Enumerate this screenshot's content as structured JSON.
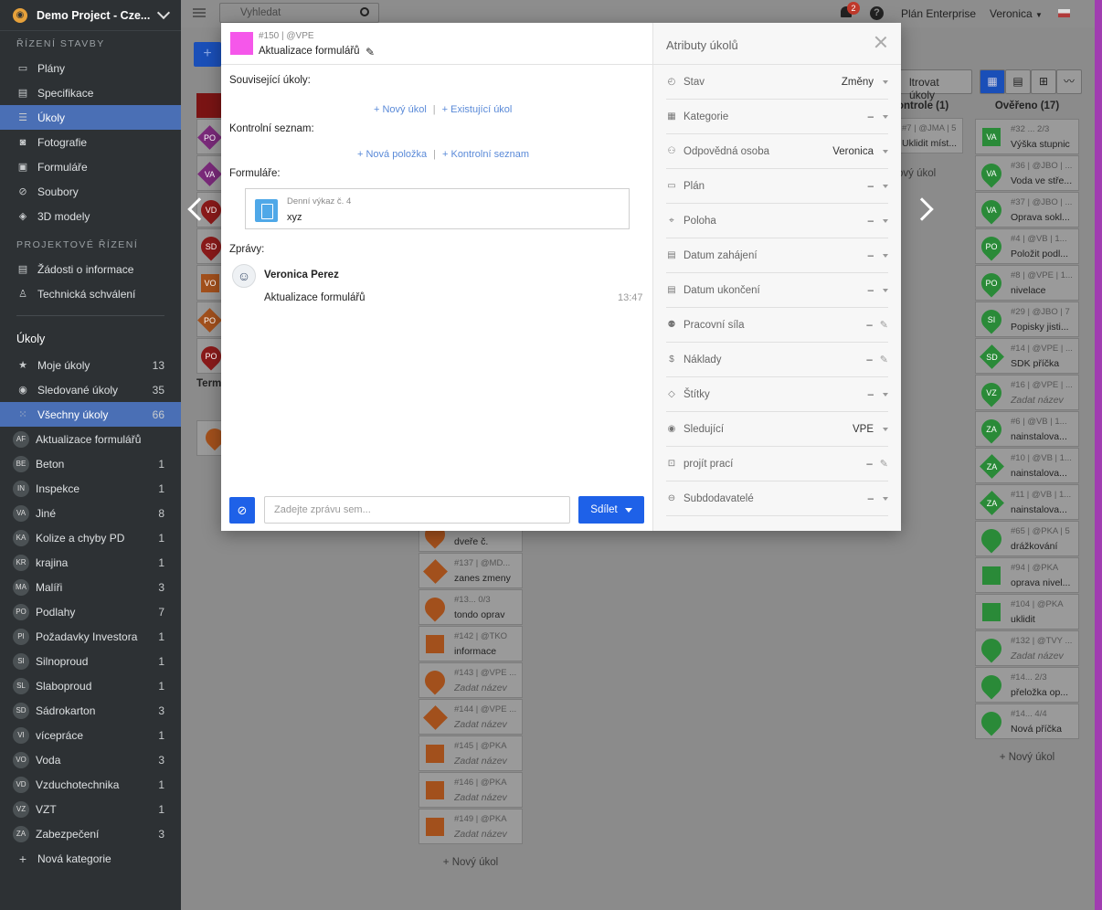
{
  "sidebar": {
    "project_name": "Demo Project - Cze...",
    "section_construction": "ŘÍZENÍ STAVBY",
    "construction_items": [
      {
        "label": "Plány",
        "icon": "map-icon"
      },
      {
        "label": "Specifikace",
        "icon": "book-icon"
      },
      {
        "label": "Úkoly",
        "icon": "list-icon",
        "active": true
      },
      {
        "label": "Fotografie",
        "icon": "camera-icon"
      },
      {
        "label": "Formuláře",
        "icon": "form-icon"
      },
      {
        "label": "Soubory",
        "icon": "paperclip-icon"
      },
      {
        "label": "3D modely",
        "icon": "cube-icon"
      }
    ],
    "section_project": "PROJEKTOVÉ ŘÍZENÍ",
    "project_items": [
      {
        "label": "Žádosti o informace",
        "icon": "document-icon"
      },
      {
        "label": "Technická schválení",
        "icon": "stamp-icon"
      }
    ],
    "tasks_heading": "Úkoly",
    "task_filters": [
      {
        "label": "Moje úkoly",
        "count": "13",
        "icon": "star-icon"
      },
      {
        "label": "Sledované úkoly",
        "count": "35",
        "icon": "eye-icon"
      },
      {
        "label": "Všechny úkoly",
        "count": "66",
        "icon": "grid-icon",
        "active": true
      }
    ],
    "categories": [
      {
        "abbr": "AF",
        "label": "Aktualizace formulářů",
        "count": ""
      },
      {
        "abbr": "BE",
        "label": "Beton",
        "count": "1"
      },
      {
        "abbr": "IN",
        "label": "Inspekce",
        "count": "1"
      },
      {
        "abbr": "VA",
        "label": "Jiné",
        "count": "8"
      },
      {
        "abbr": "KA",
        "label": "Kolize a chyby PD",
        "count": "1"
      },
      {
        "abbr": "KR",
        "label": "krajina",
        "count": "1"
      },
      {
        "abbr": "MA",
        "label": "Malíři",
        "count": "3"
      },
      {
        "abbr": "PO",
        "label": "Podlahy",
        "count": "7"
      },
      {
        "abbr": "PI",
        "label": "Požadavky Investora",
        "count": "1"
      },
      {
        "abbr": "SI",
        "label": "Silnoproud",
        "count": "1"
      },
      {
        "abbr": "SL",
        "label": "Slaboproud",
        "count": "1"
      },
      {
        "abbr": "SD",
        "label": "Sádrokarton",
        "count": "3"
      },
      {
        "abbr": "VI",
        "label": "vícepráce",
        "count": "1"
      },
      {
        "abbr": "VO",
        "label": "Voda",
        "count": "3"
      },
      {
        "abbr": "VD",
        "label": "Vzduchotechnika",
        "count": "1"
      },
      {
        "abbr": "VZ",
        "label": "VZT",
        "count": "1"
      },
      {
        "abbr": "ZA",
        "label": "Zabezpečení",
        "count": "3"
      }
    ],
    "new_category": "Nová kategorie"
  },
  "topbar": {
    "search_placeholder": "Vyhledat",
    "notifications": "2",
    "plan": "Plán Enterprise",
    "user": "Veronica"
  },
  "board": {
    "filter_button": "ltrovat úkoly",
    "term_label": "Term",
    "control_header": "ontrole (1)",
    "control_card": {
      "meta": "#7 | @JMA | 5",
      "title": "Uklidit míst..."
    },
    "control_add": "ový úkol",
    "verified_header": "Ověřeno (17)",
    "verified_cards": [
      {
        "abbr": "VA",
        "shape": "sq",
        "meta": "#32 ...    2/3",
        "title": "Výška stupnic"
      },
      {
        "abbr": "VA",
        "shape": "circ",
        "meta": "#36 | @JBO | ...",
        "title": "Voda ve stře..."
      },
      {
        "abbr": "VA",
        "shape": "circ",
        "meta": "#37 | @JBO | ...",
        "title": "Oprava sokl..."
      },
      {
        "abbr": "PO",
        "shape": "circ",
        "meta": "#4 | @VB | 1...",
        "title": "Položit podl..."
      },
      {
        "abbr": "PO",
        "shape": "circ",
        "meta": "#8 | @VPE | 1...",
        "title": "nivelace"
      },
      {
        "abbr": "SI",
        "shape": "circ",
        "meta": "#29 | @JBO | 7",
        "title": "Popisky jisti..."
      },
      {
        "abbr": "SD",
        "shape": "dia",
        "meta": "#14 | @VPE | ...",
        "title": "SDK příčka"
      },
      {
        "abbr": "VZ",
        "shape": "circ",
        "meta": "#16 | @VPE | ...",
        "title": "Zadat název",
        "italic": true
      },
      {
        "abbr": "ZA",
        "shape": "circ",
        "meta": "#6 | @VB | 1...",
        "title": "nainstalova..."
      },
      {
        "abbr": "ZA",
        "shape": "dia",
        "meta": "#10 | @VB | 1...",
        "title": "nainstalova..."
      },
      {
        "abbr": "ZA",
        "shape": "dia",
        "meta": "#11 | @VB | 1...",
        "title": "nainstalova..."
      },
      {
        "abbr": "",
        "shape": "circ",
        "meta": "#65 | @PKA | 5",
        "title": "drážkování"
      },
      {
        "abbr": "",
        "shape": "sq",
        "meta": "#94 | @PKA",
        "title": "oprava nivel..."
      },
      {
        "abbr": "",
        "shape": "sq",
        "meta": "#104 | @PKA",
        "title": "uklidit"
      },
      {
        "abbr": "",
        "shape": "circ",
        "meta": "#132 | @TVY ...",
        "title": "Zadat název",
        "italic": true
      },
      {
        "abbr": "",
        "shape": "circ",
        "meta": "#14...    2/3",
        "title": "přeložka op..."
      },
      {
        "abbr": "",
        "shape": "circ",
        "meta": "#14...    4/4",
        "title": "Nová příčka"
      }
    ],
    "verified_add": "+ Nový úkol",
    "orange_cards": [
      {
        "shape": "circ",
        "meta": "",
        "title": "dveře č."
      },
      {
        "shape": "dia",
        "meta": "#137 | @MD...",
        "title": "zanes zmeny"
      },
      {
        "shape": "circ",
        "meta": "#13...    0/3",
        "title": "tondo oprav"
      },
      {
        "shape": "sq",
        "meta": "#142 | @TKO",
        "title": "informace"
      },
      {
        "shape": "circ",
        "meta": "#143 | @VPE ...",
        "title": "Zadat název",
        "italic": true
      },
      {
        "shape": "dia",
        "meta": "#144 | @VPE ...",
        "title": "Zadat název",
        "italic": true
      },
      {
        "shape": "sq",
        "meta": "#145 | @PKA",
        "title": "Zadat název",
        "italic": true
      },
      {
        "shape": "sq",
        "meta": "#146 | @PKA",
        "title": "Zadat název",
        "italic": true
      },
      {
        "shape": "sq",
        "meta": "#149 | @PKA",
        "title": "Zadat název",
        "italic": true
      }
    ],
    "orange_add": "+ Nový úkol",
    "left_markers": [
      "PO",
      "VA",
      "VD",
      "SD",
      "VO",
      "PO",
      "PO"
    ]
  },
  "modal": {
    "task_id": "#150 | @VPE",
    "task_title": "Aktualizace formulářů",
    "related_heading": "Související úkoly:",
    "new_task": "+ Nový úkol",
    "existing_task": "+ Existující úkol",
    "checklist_heading": "Kontrolní seznam:",
    "new_item": "+ Nová položka",
    "checklist": "+ Kontrolní seznam",
    "forms_heading": "Formuláře:",
    "form_name": "Denní výkaz č. 4",
    "form_value": "xyz",
    "messages_heading": "Zprávy:",
    "message_author": "Veronica Perez",
    "message_text": "Aktualizace formulářů",
    "message_time": "13:47",
    "message_placeholder": "Zadejte zprávu sem...",
    "share_label": "Sdílet",
    "attributes_title": "Atributy úkolů",
    "attributes": [
      {
        "icon": "status-icon",
        "glyph": "◴",
        "label": "Stav",
        "value": "Změny",
        "ctrl": "dd"
      },
      {
        "icon": "category-icon",
        "glyph": "▦",
        "label": "Kategorie",
        "value": "–",
        "ctrl": "dd"
      },
      {
        "icon": "person-icon",
        "glyph": "⚇",
        "label": "Odpovědná osoba",
        "value": "Veronica",
        "ctrl": "dd"
      },
      {
        "icon": "map-icon",
        "glyph": "▭",
        "label": "Plán",
        "value": "–",
        "ctrl": "dd"
      },
      {
        "icon": "pin-icon",
        "glyph": "⌖",
        "label": "Poloha",
        "value": "–",
        "ctrl": "dd"
      },
      {
        "icon": "calendar-icon",
        "glyph": "▤",
        "label": "Datum zahájení",
        "value": "–",
        "ctrl": "dd"
      },
      {
        "icon": "calendar-icon",
        "glyph": "▤",
        "label": "Datum ukončení",
        "value": "–",
        "ctrl": "dd"
      },
      {
        "icon": "workforce-icon",
        "glyph": "⚉",
        "label": "Pracovní síla",
        "value": "–",
        "ctrl": "pen"
      },
      {
        "icon": "cost-icon",
        "glyph": "$",
        "label": "Náklady",
        "value": "–",
        "ctrl": "pen"
      },
      {
        "icon": "tag-icon",
        "glyph": "◇",
        "label": "Štítky",
        "value": "–",
        "ctrl": "dd"
      },
      {
        "icon": "eye-icon",
        "glyph": "◉",
        "label": "Sledující",
        "value": "VPE",
        "ctrl": "dd"
      },
      {
        "icon": "workflow-icon",
        "glyph": "⊡",
        "label": "projít prací",
        "value": "–",
        "ctrl": "pen"
      },
      {
        "icon": "subcontractor-icon",
        "glyph": "⊖",
        "label": "Subdodavatelé",
        "value": "–",
        "ctrl": "dd"
      }
    ]
  },
  "colors": {
    "sidebar_bg": "#2d3134",
    "active_item": "#4a6fb5",
    "accent_blue": "#1e61e8",
    "task_color": "#f557ea",
    "link": "#5a8ad8",
    "green_marker": "#2a8a38",
    "orange_marker": "#a2501c"
  }
}
